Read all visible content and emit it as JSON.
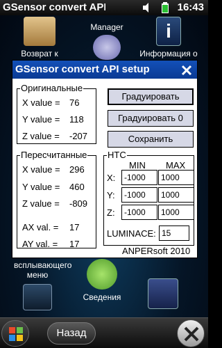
{
  "statusbar": {
    "title": "GSensor convert API s",
    "time": "16:43"
  },
  "home_icons": [
    {
      "label": "Возврат к",
      "name": "folder-icon"
    },
    {
      "label": "Manager",
      "name": "manager-icon"
    },
    {
      "label": "Информация о",
      "name": "info-icon"
    },
    {
      "label": "всплывающего\nменю",
      "name": "chart-icon"
    },
    {
      "label": "Сведения",
      "name": "speech-icon"
    },
    {
      "label": "",
      "name": "night-icon"
    }
  ],
  "taskbar": {
    "back_label": "Назад"
  },
  "dialog": {
    "title": "GSensor convert API setup",
    "original": {
      "legend": "Оригинальные",
      "x_label": "X value =",
      "x_value": "76",
      "y_label": "Y value =",
      "y_value": "118",
      "z_label": "Z value =",
      "z_value": "-207"
    },
    "recalc": {
      "legend": "Пересчитанные",
      "x_label": "X value =",
      "x_value": "296",
      "y_label": "Y value =",
      "y_value": "460",
      "z_label": "Z value =",
      "z_value": "-809",
      "ax_label": "AX val. =",
      "ax_value": "17",
      "ay_label": "AY val. =",
      "ay_value": "17"
    },
    "buttons": {
      "calibrate": "Градуировать",
      "calibrate_zero": "Градуировать 0",
      "save": "Сохранить"
    },
    "htc": {
      "legend": "HTC",
      "min_header": "MIN",
      "max_header": "MAX",
      "x_label": "X:",
      "x_min": "-1000",
      "x_max": "1000",
      "y_label": "Y:",
      "y_min": "-1000",
      "y_max": "1000",
      "z_label": "Z:",
      "z_min": "-1000",
      "z_max": "1000",
      "luminace_label": "LUMINACE:",
      "luminace_value": "15"
    },
    "footer": "ANPERsoft 2010"
  },
  "colors": {
    "title_bar": "#0a3a94",
    "button_face": "#d6d8e6"
  }
}
